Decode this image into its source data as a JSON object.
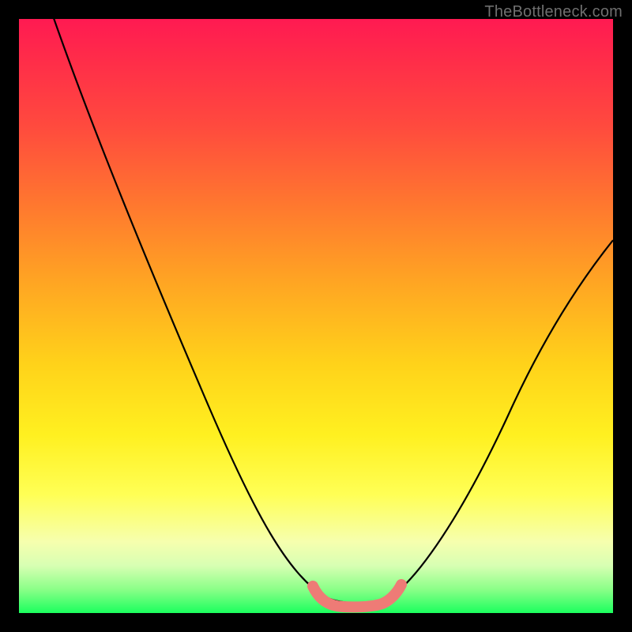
{
  "watermark": "TheBottleneck.com",
  "chart_data": {
    "type": "line",
    "title": "",
    "xlabel": "",
    "ylabel": "",
    "xlim": [
      0,
      1
    ],
    "ylim": [
      0,
      1
    ],
    "series": [
      {
        "name": "bottleneck-curve",
        "x": [
          0.0,
          0.06,
          0.12,
          0.18,
          0.24,
          0.3,
          0.36,
          0.42,
          0.48,
          0.52,
          0.56,
          0.6,
          0.63,
          0.68,
          0.74,
          0.8,
          0.86,
          0.92,
          1.0
        ],
        "values": [
          1.14,
          1.0,
          0.86,
          0.72,
          0.58,
          0.44,
          0.31,
          0.19,
          0.08,
          0.03,
          0.01,
          0.01,
          0.03,
          0.09,
          0.19,
          0.3,
          0.41,
          0.51,
          0.63
        ]
      },
      {
        "name": "optimal-band-marker",
        "x": [
          0.5,
          0.52,
          0.55,
          0.58,
          0.61,
          0.63
        ],
        "values": [
          0.035,
          0.02,
          0.012,
          0.012,
          0.02,
          0.035
        ]
      }
    ],
    "annotations": [
      {
        "text": "TheBottleneck.com",
        "role": "watermark",
        "position": "top-right"
      }
    ]
  }
}
